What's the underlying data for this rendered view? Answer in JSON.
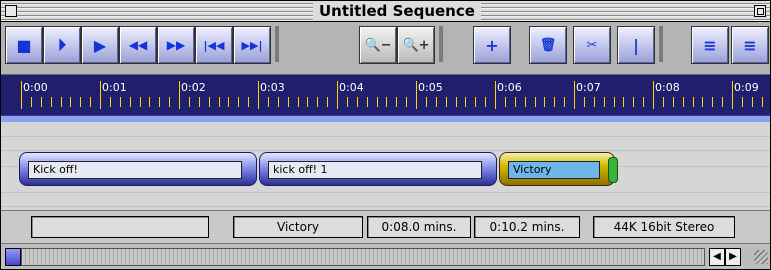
{
  "window": {
    "title": "Untitled Sequence"
  },
  "toolbar": {
    "buttons": [
      {
        "name": "stop-button",
        "glyph": "■"
      },
      {
        "name": "play-from-start-button",
        "glyph": "⏵"
      },
      {
        "name": "play-button",
        "glyph": "▶"
      },
      {
        "name": "rewind-button",
        "glyph": "◀◀"
      },
      {
        "name": "fast-forward-button",
        "glyph": "▶▶"
      },
      {
        "name": "go-to-start-button",
        "glyph": "|◀◀"
      },
      {
        "name": "go-to-end-button",
        "glyph": "▶▶|"
      }
    ],
    "zoom_out_glyph": "🔍−",
    "zoom_in_glyph": "🔍+",
    "track_tools": [
      {
        "name": "add-track-button",
        "glyph": "+"
      },
      {
        "name": "delete-track-button",
        "glyph": "🗑"
      },
      {
        "name": "split-clip-button",
        "glyph": "✂"
      },
      {
        "name": "trim-clip-button",
        "glyph": "|"
      },
      {
        "name": "align-clips-button",
        "glyph": "≡"
      },
      {
        "name": "merge-clips-button",
        "glyph": "≡"
      }
    ]
  },
  "ruler": {
    "labels": [
      "0:00",
      "0:01",
      "0:02",
      "0:03",
      "0:04",
      "0:05",
      "0:06",
      "0:07",
      "0:08",
      "0:09"
    ]
  },
  "clips": [
    {
      "label": "Kick off!",
      "selected": false
    },
    {
      "label": "kick off! 1",
      "selected": false
    },
    {
      "label": "Victory",
      "selected": true
    }
  ],
  "status": {
    "blank": "",
    "clip_name": "Victory",
    "position": "0:08.0 mins.",
    "duration": "0:10.2 mins.",
    "format": "44K 16bit Stereo"
  },
  "scrollbar": {
    "left_arrow": "◀",
    "right_arrow": "▶"
  },
  "colors": {
    "ruler_bg": "#1f1f6e",
    "ruler_ticks": "#ffd400",
    "clip_blue": "#5a61c8",
    "clip_selected_gold": "#d4b800",
    "clip_selected_cap": "#6fb6e8"
  }
}
